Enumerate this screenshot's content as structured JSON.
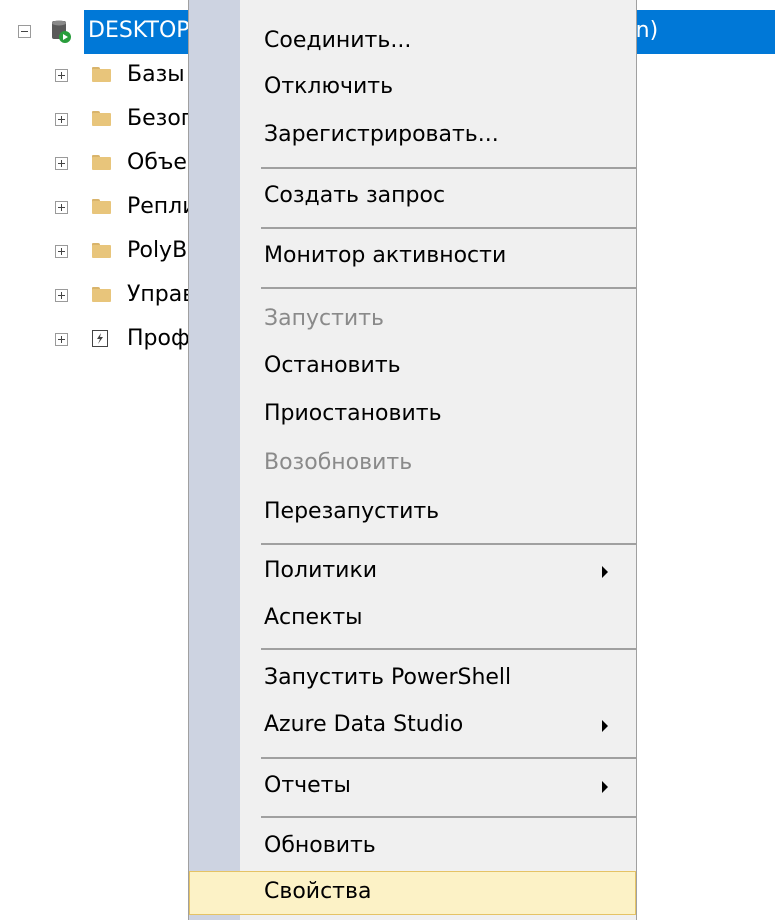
{
  "tree": {
    "server_label": "DESKTOP-DNK0N7L (SQL Server 15.0.2000 - admin)",
    "children": [
      {
        "label": "Базы данных",
        "icon": "folder-icon"
      },
      {
        "label": "Безопасность",
        "icon": "folder-icon"
      },
      {
        "label": "Объекты сервера",
        "icon": "folder-icon"
      },
      {
        "label": "Репликация",
        "icon": "folder-icon"
      },
      {
        "label": "PolyBase",
        "icon": "folder-icon"
      },
      {
        "label": "Управление",
        "icon": "folder-icon"
      },
      {
        "label": "Профилировщик XEvent",
        "icon": "xevent-profiler-icon"
      }
    ]
  },
  "context_menu": {
    "items": [
      {
        "label": "Соединить...",
        "enabled": true
      },
      {
        "label": "Отключить",
        "enabled": true
      },
      {
        "label": "Зарегистрировать...",
        "enabled": true
      },
      {
        "label": "Создать запрос",
        "enabled": true
      },
      {
        "label": "Монитор активности",
        "enabled": true
      },
      {
        "label": "Запустить",
        "enabled": false
      },
      {
        "label": "Остановить",
        "enabled": true
      },
      {
        "label": "Приостановить",
        "enabled": true
      },
      {
        "label": "Возобновить",
        "enabled": false
      },
      {
        "label": "Перезапустить",
        "enabled": true
      },
      {
        "label": "Политики",
        "enabled": true,
        "submenu": true
      },
      {
        "label": "Аспекты",
        "enabled": true
      },
      {
        "label": "Запустить PowerShell",
        "enabled": true
      },
      {
        "label": "Azure Data Studio",
        "enabled": true,
        "submenu": true
      },
      {
        "label": "Отчеты",
        "enabled": true,
        "submenu": true
      },
      {
        "label": "Обновить",
        "enabled": true
      },
      {
        "label": "Свойства",
        "enabled": true,
        "hovered": true
      }
    ]
  },
  "colors": {
    "selection": "#0078d7",
    "menu_background": "#f0f0f0",
    "menu_gutter": "#cdd3e1",
    "hover_background": "#fcf2c6",
    "hover_border": "#e5c365",
    "disabled_text": "#8a8a8a",
    "folder": "#e8c57b"
  }
}
